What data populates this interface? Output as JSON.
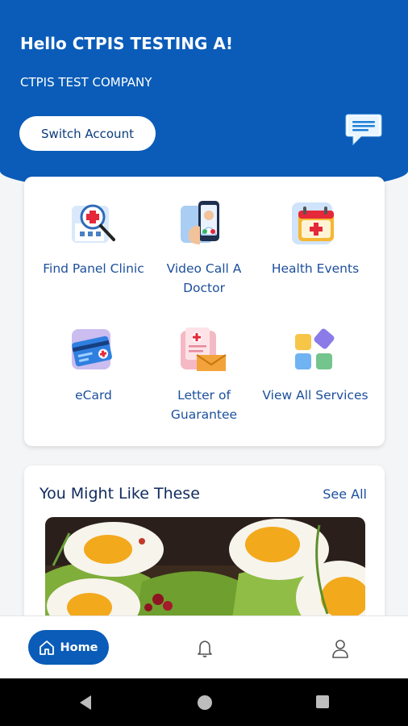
{
  "header": {
    "greeting": "Hello CTPIS TESTING A!",
    "company": "CTPIS TEST COMPANY",
    "switch_account": "Switch Account",
    "chat_icon": "chat-bubble-icon"
  },
  "services": [
    {
      "label": "Find Panel Clinic",
      "icon": "clinic-search-icon"
    },
    {
      "label": "Video Call A Doctor",
      "icon": "video-call-icon"
    },
    {
      "label": "Health Events",
      "icon": "calendar-health-icon"
    },
    {
      "label": "eCard",
      "icon": "ecard-icon"
    },
    {
      "label": "Letter of Guarantee",
      "icon": "letter-icon"
    },
    {
      "label": "View All Services",
      "icon": "grid-services-icon"
    }
  ],
  "recommendations": {
    "title": "You Might Like These",
    "see_all": "See All",
    "image": "food-eggs-avocado-toast"
  },
  "bottom_nav": {
    "home": "Home",
    "notifications_icon": "bell-icon",
    "profile_icon": "user-icon"
  },
  "colors": {
    "primary": "#0a5cb8",
    "text_blue": "#1c4f9c",
    "background": "#f4f5f7"
  }
}
